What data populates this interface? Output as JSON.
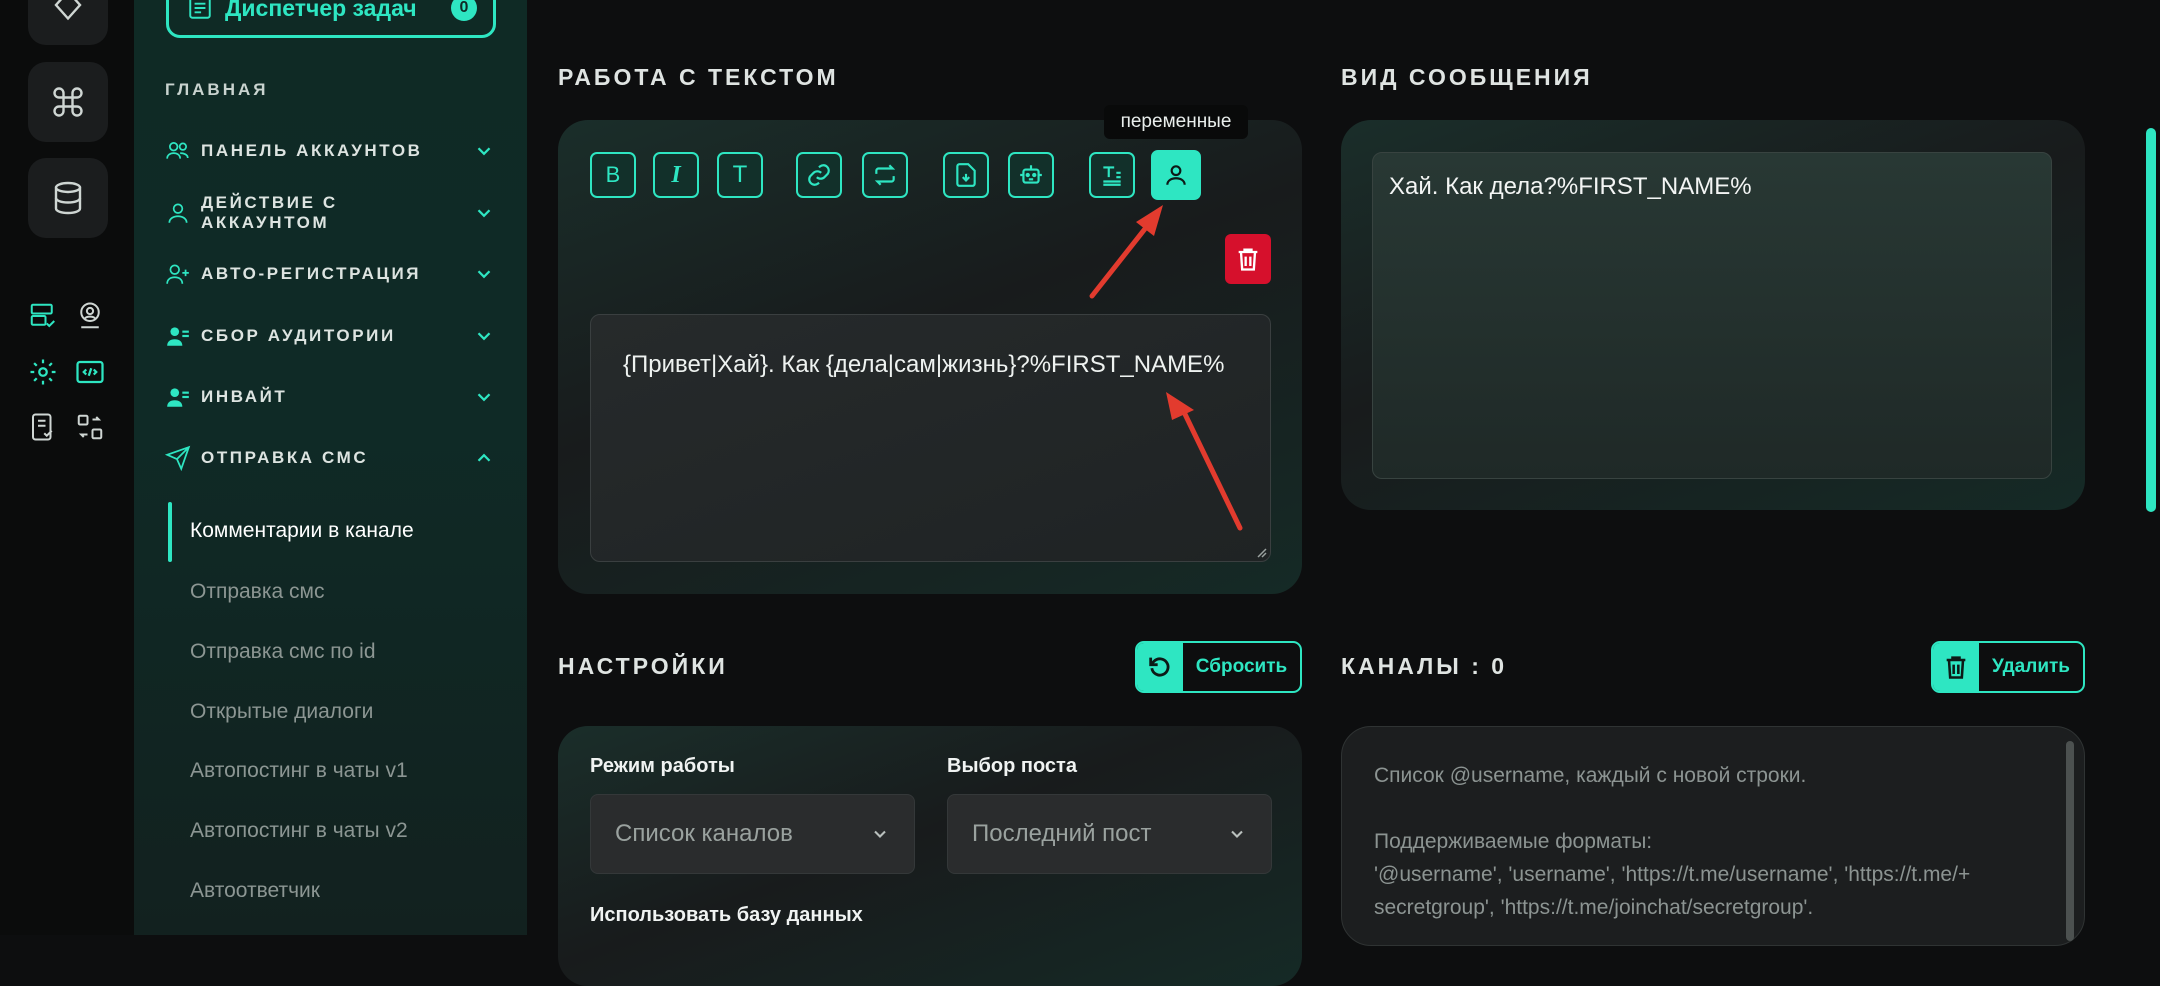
{
  "sidebar": {
    "task_manager_label": "Диспетчер задач",
    "task_manager_count": "0",
    "section_title": "ГЛАВНАЯ",
    "items": [
      {
        "label": "ПАНЕЛЬ АККАУНТОВ"
      },
      {
        "label": "ДЕЙСТВИЕ С АККАУНТОМ"
      },
      {
        "label": "АВТО-РЕГИСТРАЦИЯ"
      },
      {
        "label": "СБОР АУДИТОРИИ"
      },
      {
        "label": "ИНВАЙТ"
      },
      {
        "label": "ОТПРАВКА СМС"
      }
    ],
    "sub_items": [
      {
        "label": "Комментарии в канале"
      },
      {
        "label": "Отправка смс"
      },
      {
        "label": "Отправка смс по id"
      },
      {
        "label": "Открытые диалоги"
      },
      {
        "label": "Автопостинг в чаты v1"
      },
      {
        "label": "Автопостинг в чаты v2"
      },
      {
        "label": "Автоответчик"
      }
    ]
  },
  "text_work": {
    "title": "РАБОТА С ТЕКСТОМ",
    "tooltip": "переменные",
    "toolbar_bold": "B",
    "toolbar_italic": "I",
    "toolbar_text": "T",
    "message_text": "{Привет|Хай}. Как {дела|сам|жизнь}?%FIRST_NAME%"
  },
  "message_view": {
    "title": "ВИД СООБЩЕНИЯ",
    "preview_text": "Хай. Как дела?%FIRST_NAME%"
  },
  "settings": {
    "title": "НАСТРОЙКИ",
    "reset_label": "Сбросить",
    "mode_label": "Режим работы",
    "mode_value": "Список каналов",
    "post_label": "Выбор поста",
    "post_value": "Последний пост",
    "use_db_label": "Использовать базу данных"
  },
  "channels": {
    "title": "КАНАЛЫ : 0",
    "delete_label": "Удалить",
    "placeholder_line1": "Список @username, каждый с новой строки.",
    "placeholder_line2": "Поддерживаемые форматы:",
    "placeholder_line3": "'@username', 'username', 'https://t.me/username', 'https://t.me/+",
    "placeholder_line4": "secretgroup', 'https://t.me/joinchat/secretgroup'."
  },
  "colors": {
    "accent": "#2ee6c2",
    "danger": "#d6102c",
    "background": "#0d0e0f"
  }
}
